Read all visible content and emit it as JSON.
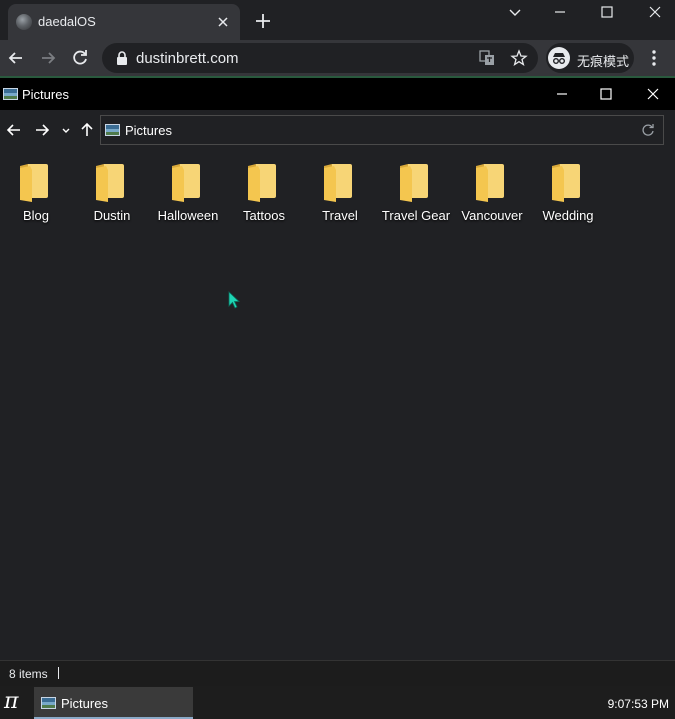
{
  "browser": {
    "tab": {
      "title": "daedalOS"
    },
    "url": "dustinbrett.com",
    "incognito_label": "无痕模式"
  },
  "window": {
    "title": "Pictures"
  },
  "address": {
    "path": "Pictures"
  },
  "folders": [
    {
      "label": "Blog"
    },
    {
      "label": "Dustin"
    },
    {
      "label": "Halloween"
    },
    {
      "label": "Tattoos"
    },
    {
      "label": "Travel"
    },
    {
      "label": "Travel Gear"
    },
    {
      "label": "Vancouver"
    },
    {
      "label": "Wedding"
    }
  ],
  "status": {
    "item_count": "8 items"
  },
  "taskbar": {
    "start_glyph": "π",
    "entry_label": "Pictures",
    "clock": "9:07:53 PM"
  },
  "colors": {
    "accent_cursor": "#1fd5b4",
    "folder": "#f4c64f",
    "background": "#202124"
  }
}
